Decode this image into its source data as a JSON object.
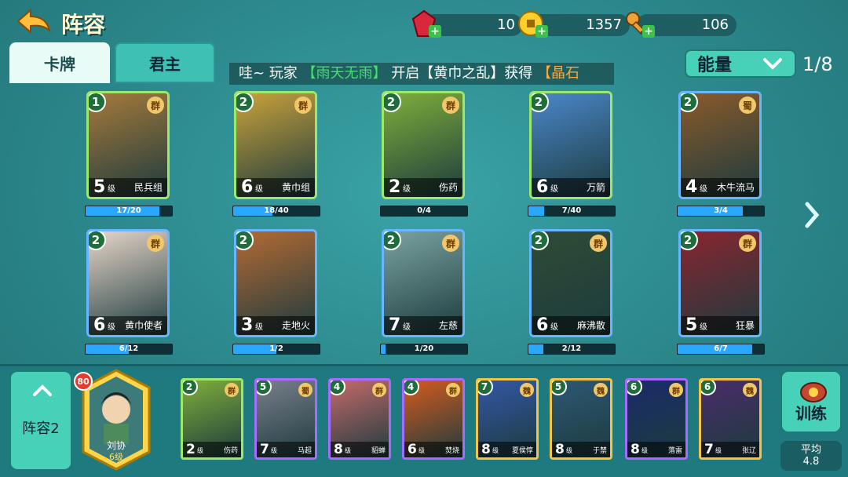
{
  "header": {
    "title": "阵容",
    "resources": [
      {
        "name": "ruby",
        "value": "10",
        "icon": "ruby-gem-icon"
      },
      {
        "name": "gold",
        "value": "1357",
        "icon": "gold-coin-icon"
      },
      {
        "name": "key",
        "value": "106",
        "icon": "key-icon"
      }
    ]
  },
  "tabs": [
    {
      "label": "卡牌",
      "active": true
    },
    {
      "label": "君主",
      "active": false
    }
  ],
  "ticker": {
    "prefix": "哇~ 玩家",
    "player": "【雨天无雨】",
    "middle": "开启【黄巾之乱】获得",
    "item": "【晶石"
  },
  "filter": {
    "label": "能量",
    "page": "1/8"
  },
  "cards": [
    {
      "cost": "1",
      "faction": "群",
      "level": "5",
      "suffix": "级",
      "name": "民兵组",
      "progress": "17/20",
      "ratio": 0.85,
      "color": "green",
      "theme": "#a57a3b"
    },
    {
      "cost": "2",
      "faction": "群",
      "level": "6",
      "suffix": "级",
      "name": "黄巾组",
      "progress": "18/40",
      "ratio": 0.45,
      "color": "green",
      "theme": "#c9a23b"
    },
    {
      "cost": "2",
      "faction": "群",
      "level": "2",
      "suffix": "级",
      "name": "伤药",
      "progress": "0/4",
      "ratio": 0.0,
      "color": "green",
      "theme": "#7fae3a"
    },
    {
      "cost": "2",
      "faction": "",
      "level": "6",
      "suffix": "级",
      "name": "万箭",
      "progress": "7/40",
      "ratio": 0.175,
      "color": "green",
      "theme": "#4a87c9"
    },
    {
      "cost": "2",
      "faction": "蜀",
      "level": "4",
      "suffix": "级",
      "name": "木牛流马",
      "progress": "3/4",
      "ratio": 0.75,
      "color": "blue",
      "theme": "#8a5a2b"
    },
    {
      "cost": "2",
      "faction": "群",
      "level": "6",
      "suffix": "级",
      "name": "黄巾使者",
      "progress": "6/12",
      "ratio": 0.5,
      "color": "blue",
      "theme": "#e7d6c9"
    },
    {
      "cost": "2",
      "faction": "",
      "level": "3",
      "suffix": "级",
      "name": "走地火",
      "progress": "1/2",
      "ratio": 0.5,
      "color": "blue",
      "theme": "#b46a34"
    },
    {
      "cost": "2",
      "faction": "群",
      "level": "7",
      "suffix": "级",
      "name": "左慈",
      "progress": "1/20",
      "ratio": 0.05,
      "color": "blue",
      "theme": "#7aa3a0"
    },
    {
      "cost": "2",
      "faction": "群",
      "level": "6",
      "suffix": "级",
      "name": "麻沸散",
      "progress": "2/12",
      "ratio": 0.17,
      "color": "blue",
      "theme": "#2f4c35"
    },
    {
      "cost": "2",
      "faction": "群",
      "level": "5",
      "suffix": "级",
      "name": "狂暴",
      "progress": "6/7",
      "ratio": 0.86,
      "color": "blue",
      "theme": "#8a2530"
    }
  ],
  "deck": {
    "lineup_label": "阵容2",
    "hero": {
      "name": "刘协",
      "level": "6级",
      "badge": "80"
    },
    "train_label": "训练",
    "avg_label": "平均",
    "avg_value": "4.8",
    "cards": [
      {
        "cost": "2",
        "faction": "群",
        "level": "2",
        "suffix": "级",
        "name": "伤药",
        "color": "green",
        "theme": "#7fae3a"
      },
      {
        "cost": "5",
        "faction": "蜀",
        "level": "7",
        "suffix": "级",
        "name": "马超",
        "color": "purple",
        "theme": "#7a7f8a"
      },
      {
        "cost": "4",
        "faction": "群",
        "level": "8",
        "suffix": "级",
        "name": "貂蝉",
        "color": "purple",
        "theme": "#c46a6a"
      },
      {
        "cost": "4",
        "faction": "群",
        "level": "6",
        "suffix": "级",
        "name": "焚烧",
        "color": "purple",
        "theme": "#d35b1d"
      },
      {
        "cost": "7",
        "faction": "魏",
        "level": "8",
        "suffix": "级",
        "name": "夏侯惇",
        "color": "gold",
        "theme": "#3357a6"
      },
      {
        "cost": "5",
        "faction": "魏",
        "level": "8",
        "suffix": "级",
        "name": "于禁",
        "color": "gold",
        "theme": "#2d5874"
      },
      {
        "cost": "6",
        "faction": "群",
        "level": "8",
        "suffix": "级",
        "name": "落雷",
        "color": "purple",
        "theme": "#1a2b6a"
      },
      {
        "cost": "6",
        "faction": "魏",
        "level": "7",
        "suffix": "级",
        "name": "张辽",
        "color": "gold",
        "theme": "#4a2c6a"
      }
    ]
  }
}
